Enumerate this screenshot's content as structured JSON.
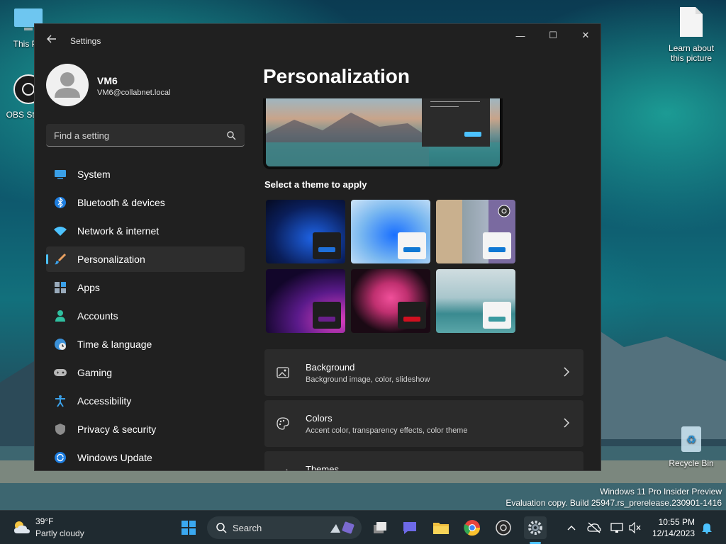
{
  "desktop": {
    "icons": [
      {
        "label": "This PC"
      },
      {
        "label": "OBS Studio"
      },
      {
        "label": "Learn about this picture"
      },
      {
        "label": "Recycle Bin"
      }
    ],
    "watermark": {
      "line1": "Windows 11 Pro Insider Preview",
      "line2": "Evaluation copy. Build 25947.rs_prerelease.230901-1416"
    }
  },
  "window": {
    "title": "Settings",
    "controls": {
      "minimize": "—",
      "maximize": "☐",
      "close": "✕"
    },
    "profile": {
      "name": "VM6",
      "email": "VM6@collabnet.local"
    },
    "search": {
      "placeholder": "Find a setting"
    },
    "nav": [
      {
        "label": "System",
        "icon": "system-icon",
        "active": false
      },
      {
        "label": "Bluetooth & devices",
        "icon": "bluetooth-icon",
        "active": false
      },
      {
        "label": "Network & internet",
        "icon": "wifi-icon",
        "active": false
      },
      {
        "label": "Personalization",
        "icon": "brush-icon",
        "active": true
      },
      {
        "label": "Apps",
        "icon": "apps-icon",
        "active": false
      },
      {
        "label": "Accounts",
        "icon": "accounts-icon",
        "active": false
      },
      {
        "label": "Time & language",
        "icon": "globe-clock-icon",
        "active": false
      },
      {
        "label": "Gaming",
        "icon": "gamepad-icon",
        "active": false
      },
      {
        "label": "Accessibility",
        "icon": "accessibility-icon",
        "active": false
      },
      {
        "label": "Privacy & security",
        "icon": "shield-icon",
        "active": false
      },
      {
        "label": "Windows Update",
        "icon": "update-icon",
        "active": false
      }
    ],
    "page_title": "Personalization",
    "themes_heading": "Select a theme to apply",
    "themes": [
      {
        "name": "windows-dark-bloom",
        "accent": "#1e6fd9"
      },
      {
        "name": "windows-light-bloom",
        "accent": "#0f78d4"
      },
      {
        "name": "windows-spotlight",
        "accent": "#0f78d4"
      },
      {
        "name": "glow",
        "accent": "#6a1f8c"
      },
      {
        "name": "captured-motion",
        "accent": "#d01020"
      },
      {
        "name": "flow",
        "accent": "#3a9aa0"
      }
    ],
    "cards": [
      {
        "title": "Background",
        "subtitle": "Background image, color, slideshow",
        "icon": "image-icon"
      },
      {
        "title": "Colors",
        "subtitle": "Accent color, transparency effects, color theme",
        "icon": "palette-icon"
      },
      {
        "title": "Themes",
        "subtitle": "",
        "icon": "brush-icon"
      }
    ],
    "accent_color": "#4cc2ff"
  },
  "taskbar": {
    "weather": {
      "temp": "39°F",
      "desc": "Partly cloudy"
    },
    "search_label": "Search",
    "time": "10:55 PM",
    "date": "12/14/2023"
  }
}
